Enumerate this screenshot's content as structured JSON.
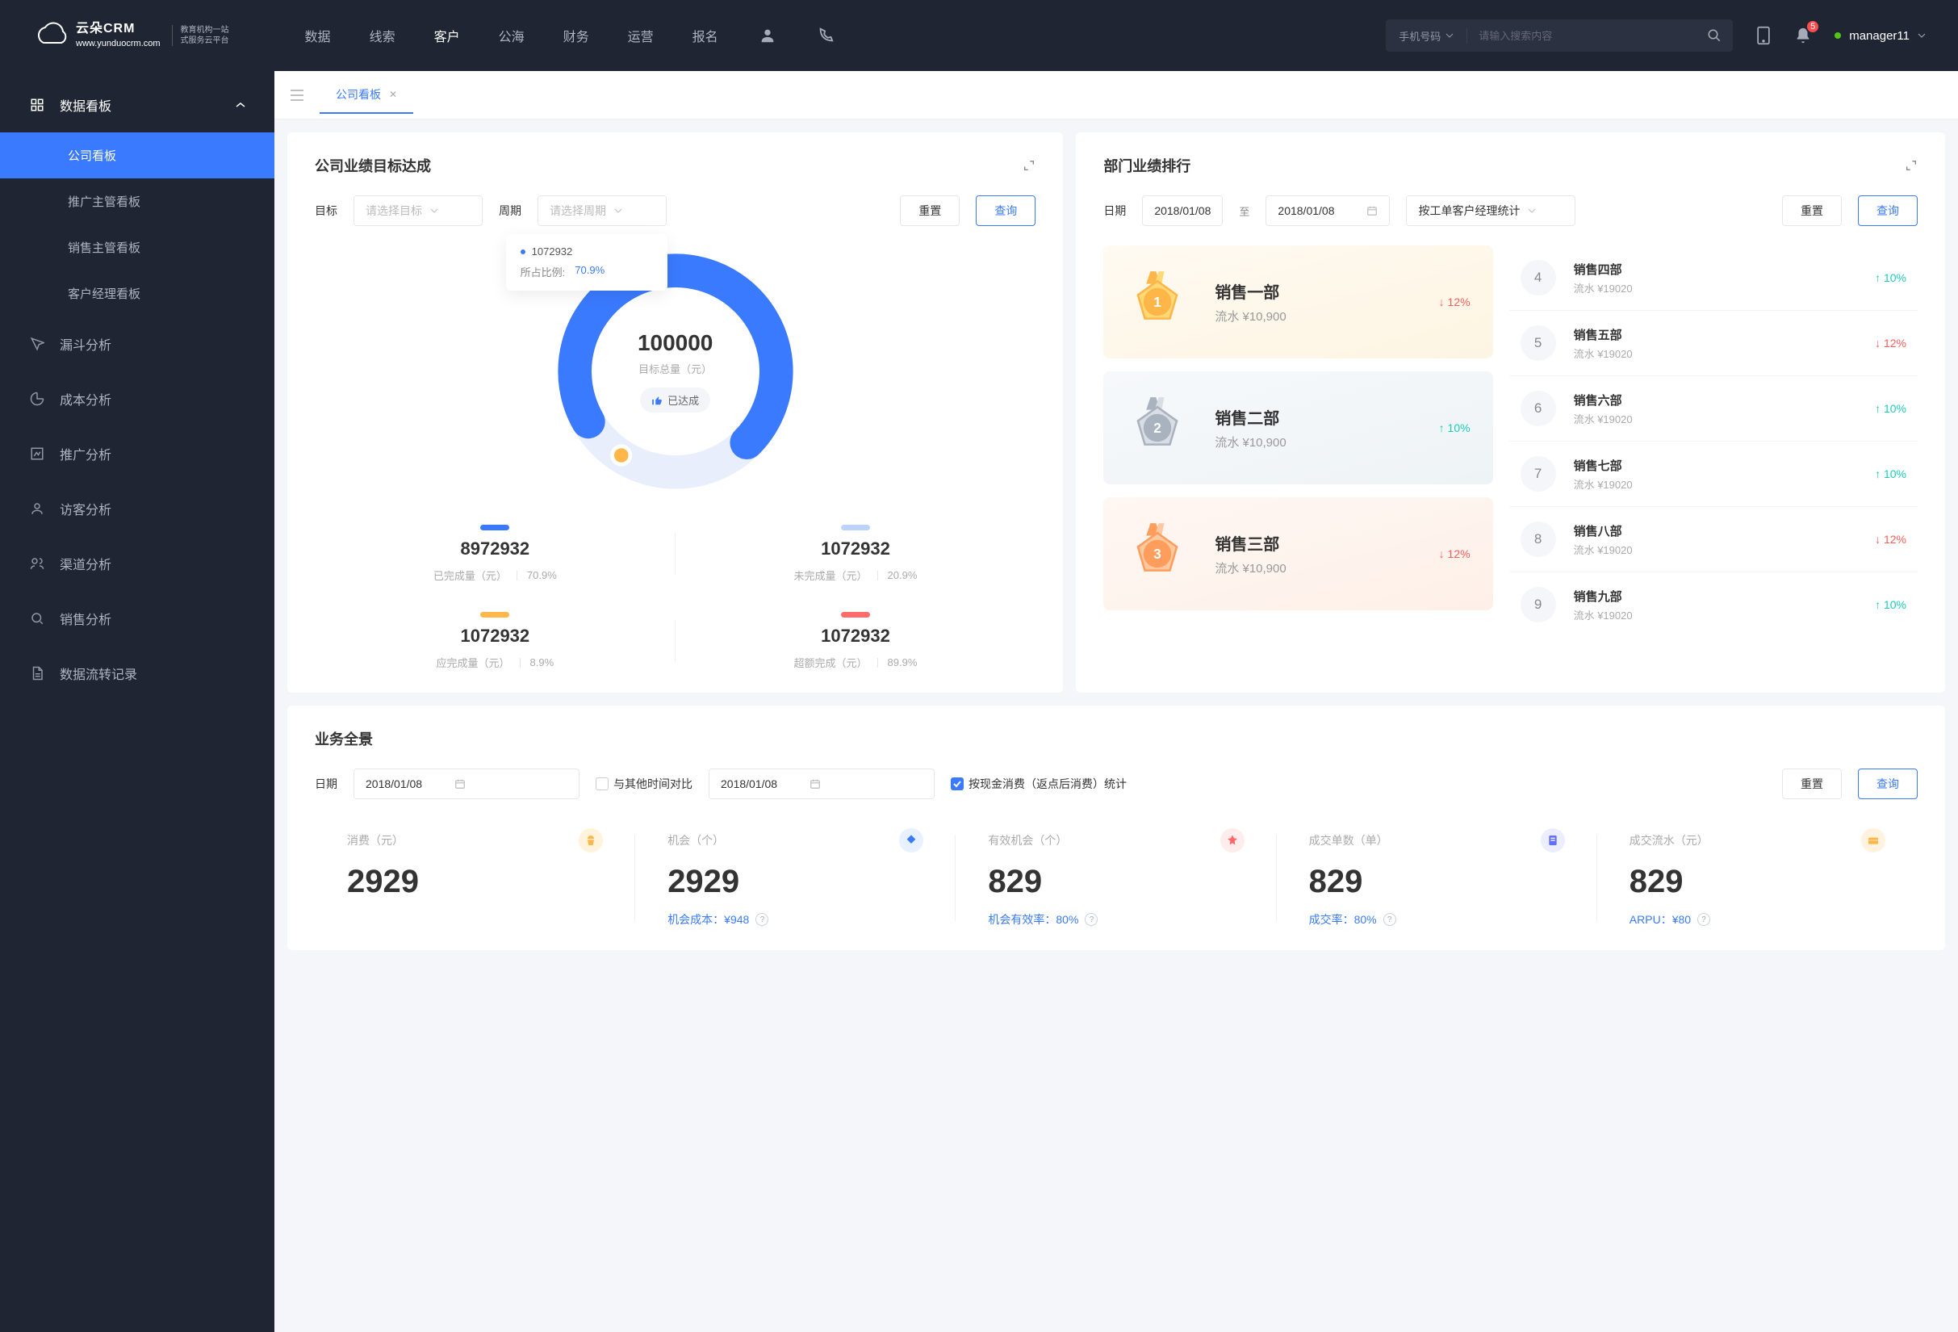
{
  "brand": {
    "name": "云朵CRM",
    "tagline1": "教育机构一站",
    "tagline2": "式服务云平台",
    "url": "www.yunduocrm.com"
  },
  "topnav": {
    "items": [
      "数据",
      "线索",
      "客户",
      "公海",
      "财务",
      "运营",
      "报名"
    ],
    "active_index": 2
  },
  "search": {
    "type": "手机号码",
    "placeholder": "请输入搜索内容"
  },
  "notify_count": "5",
  "user": {
    "name": "manager11"
  },
  "sidebar": {
    "main": {
      "label": "数据看板",
      "subs": [
        "公司看板",
        "推广主管看板",
        "销售主管看板",
        "客户经理看板"
      ],
      "active_sub": 0
    },
    "items": [
      "漏斗分析",
      "成本分析",
      "推广分析",
      "访客分析",
      "渠道分析",
      "销售分析",
      "数据流转记录"
    ]
  },
  "tabs": {
    "current": "公司看板"
  },
  "goal": {
    "title": "公司业绩目标达成",
    "target_label": "目标",
    "target_ph": "请选择目标",
    "period_label": "周期",
    "period_ph": "请选择周期",
    "reset": "重置",
    "query": "查询",
    "tooltip": {
      "value": "1072932",
      "ratio_label": "所占比例:",
      "ratio": "70.9%"
    },
    "center": {
      "total": "100000",
      "total_label": "目标总量（元）",
      "pill": "已达成"
    },
    "stats": [
      {
        "bar": "#3a7afe",
        "val": "8972932",
        "label": "已完成量（元）",
        "pct": "70.9%"
      },
      {
        "bar": "#bcd4fb",
        "val": "1072932",
        "label": "未完成量（元）",
        "pct": "20.9%"
      },
      {
        "bar": "#ffb74a",
        "val": "1072932",
        "label": "应完成量（元）",
        "pct": "8.9%"
      },
      {
        "bar": "#ff6b6b",
        "val": "1072932",
        "label": "超额完成（元）",
        "pct": "89.9%"
      }
    ]
  },
  "rank": {
    "title": "部门业绩排行",
    "date_label": "日期",
    "d1": "2018/01/08",
    "sep": "至",
    "d2": "2018/01/08",
    "group_by": "按工单客户经理统计",
    "reset": "重置",
    "query": "查询",
    "podium": [
      {
        "rank": 1,
        "name": "销售一部",
        "rev": "流水 ¥10,900",
        "trend": "down",
        "pct": "12%"
      },
      {
        "rank": 2,
        "name": "销售二部",
        "rev": "流水 ¥10,900",
        "trend": "up",
        "pct": "10%"
      },
      {
        "rank": 3,
        "name": "销售三部",
        "rev": "流水 ¥10,900",
        "trend": "down",
        "pct": "12%"
      }
    ],
    "list": [
      {
        "n": "4",
        "name": "销售四部",
        "rev": "流水 ¥19020",
        "trend": "up",
        "pct": "10%"
      },
      {
        "n": "5",
        "name": "销售五部",
        "rev": "流水 ¥19020",
        "trend": "down",
        "pct": "12%"
      },
      {
        "n": "6",
        "name": "销售六部",
        "rev": "流水 ¥19020",
        "trend": "up",
        "pct": "10%"
      },
      {
        "n": "7",
        "name": "销售七部",
        "rev": "流水 ¥19020",
        "trend": "up",
        "pct": "10%"
      },
      {
        "n": "8",
        "name": "销售八部",
        "rev": "流水 ¥19020",
        "trend": "down",
        "pct": "12%"
      },
      {
        "n": "9",
        "name": "销售九部",
        "rev": "流水 ¥19020",
        "trend": "up",
        "pct": "10%"
      }
    ]
  },
  "pano": {
    "title": "业务全景",
    "date_label": "日期",
    "date": "2018/01/08",
    "compare": "与其他时间对比",
    "date2": "2018/01/08",
    "bycash": "按现金消费（返点后消费）统计",
    "reset": "重置",
    "query": "查询",
    "cards": [
      {
        "label": "消费（元）",
        "icon_bg": "#fff3dc",
        "icon_fg": "#ffb648",
        "val": "2929",
        "foot": ""
      },
      {
        "label": "机会（个）",
        "icon_bg": "#e8f1ff",
        "icon_fg": "#3a7afe",
        "val": "2929",
        "foot": "机会成本：¥948"
      },
      {
        "label": "有效机会（个）",
        "icon_bg": "#ffecec",
        "icon_fg": "#ff6767",
        "val": "829",
        "foot": "机会有效率：80%"
      },
      {
        "label": "成交单数（单）",
        "icon_bg": "#eceeff",
        "icon_fg": "#6370ff",
        "val": "829",
        "foot": "成交率：80%"
      },
      {
        "label": "成交流水（元）",
        "icon_bg": "#fff2de",
        "icon_fg": "#ffb648",
        "val": "829",
        "foot": "ARPU：¥80"
      }
    ]
  },
  "chart_data": {
    "type": "pie",
    "title": "目标总量（元）",
    "total": 100000,
    "series": [
      {
        "name": "已完成",
        "value": 70.9,
        "color": "#3a7afe"
      },
      {
        "name": "未完成",
        "value": 29.1,
        "color": "#e8eefb"
      }
    ]
  }
}
